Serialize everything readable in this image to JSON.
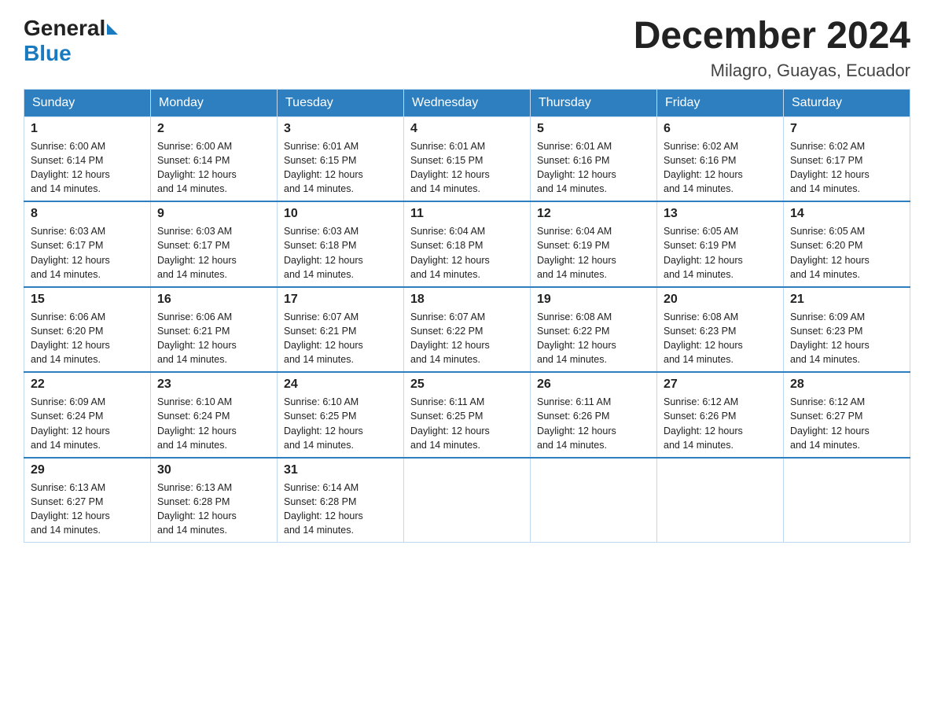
{
  "logo": {
    "general": "General",
    "triangle": "",
    "blue": "Blue"
  },
  "title": "December 2024",
  "location": "Milagro, Guayas, Ecuador",
  "days_of_week": [
    "Sunday",
    "Monday",
    "Tuesday",
    "Wednesday",
    "Thursday",
    "Friday",
    "Saturday"
  ],
  "weeks": [
    [
      {
        "day": "1",
        "sunrise": "6:00 AM",
        "sunset": "6:14 PM",
        "daylight": "12 hours and 14 minutes."
      },
      {
        "day": "2",
        "sunrise": "6:00 AM",
        "sunset": "6:14 PM",
        "daylight": "12 hours and 14 minutes."
      },
      {
        "day": "3",
        "sunrise": "6:01 AM",
        "sunset": "6:15 PM",
        "daylight": "12 hours and 14 minutes."
      },
      {
        "day": "4",
        "sunrise": "6:01 AM",
        "sunset": "6:15 PM",
        "daylight": "12 hours and 14 minutes."
      },
      {
        "day": "5",
        "sunrise": "6:01 AM",
        "sunset": "6:16 PM",
        "daylight": "12 hours and 14 minutes."
      },
      {
        "day": "6",
        "sunrise": "6:02 AM",
        "sunset": "6:16 PM",
        "daylight": "12 hours and 14 minutes."
      },
      {
        "day": "7",
        "sunrise": "6:02 AM",
        "sunset": "6:17 PM",
        "daylight": "12 hours and 14 minutes."
      }
    ],
    [
      {
        "day": "8",
        "sunrise": "6:03 AM",
        "sunset": "6:17 PM",
        "daylight": "12 hours and 14 minutes."
      },
      {
        "day": "9",
        "sunrise": "6:03 AM",
        "sunset": "6:17 PM",
        "daylight": "12 hours and 14 minutes."
      },
      {
        "day": "10",
        "sunrise": "6:03 AM",
        "sunset": "6:18 PM",
        "daylight": "12 hours and 14 minutes."
      },
      {
        "day": "11",
        "sunrise": "6:04 AM",
        "sunset": "6:18 PM",
        "daylight": "12 hours and 14 minutes."
      },
      {
        "day": "12",
        "sunrise": "6:04 AM",
        "sunset": "6:19 PM",
        "daylight": "12 hours and 14 minutes."
      },
      {
        "day": "13",
        "sunrise": "6:05 AM",
        "sunset": "6:19 PM",
        "daylight": "12 hours and 14 minutes."
      },
      {
        "day": "14",
        "sunrise": "6:05 AM",
        "sunset": "6:20 PM",
        "daylight": "12 hours and 14 minutes."
      }
    ],
    [
      {
        "day": "15",
        "sunrise": "6:06 AM",
        "sunset": "6:20 PM",
        "daylight": "12 hours and 14 minutes."
      },
      {
        "day": "16",
        "sunrise": "6:06 AM",
        "sunset": "6:21 PM",
        "daylight": "12 hours and 14 minutes."
      },
      {
        "day": "17",
        "sunrise": "6:07 AM",
        "sunset": "6:21 PM",
        "daylight": "12 hours and 14 minutes."
      },
      {
        "day": "18",
        "sunrise": "6:07 AM",
        "sunset": "6:22 PM",
        "daylight": "12 hours and 14 minutes."
      },
      {
        "day": "19",
        "sunrise": "6:08 AM",
        "sunset": "6:22 PM",
        "daylight": "12 hours and 14 minutes."
      },
      {
        "day": "20",
        "sunrise": "6:08 AM",
        "sunset": "6:23 PM",
        "daylight": "12 hours and 14 minutes."
      },
      {
        "day": "21",
        "sunrise": "6:09 AM",
        "sunset": "6:23 PM",
        "daylight": "12 hours and 14 minutes."
      }
    ],
    [
      {
        "day": "22",
        "sunrise": "6:09 AM",
        "sunset": "6:24 PM",
        "daylight": "12 hours and 14 minutes."
      },
      {
        "day": "23",
        "sunrise": "6:10 AM",
        "sunset": "6:24 PM",
        "daylight": "12 hours and 14 minutes."
      },
      {
        "day": "24",
        "sunrise": "6:10 AM",
        "sunset": "6:25 PM",
        "daylight": "12 hours and 14 minutes."
      },
      {
        "day": "25",
        "sunrise": "6:11 AM",
        "sunset": "6:25 PM",
        "daylight": "12 hours and 14 minutes."
      },
      {
        "day": "26",
        "sunrise": "6:11 AM",
        "sunset": "6:26 PM",
        "daylight": "12 hours and 14 minutes."
      },
      {
        "day": "27",
        "sunrise": "6:12 AM",
        "sunset": "6:26 PM",
        "daylight": "12 hours and 14 minutes."
      },
      {
        "day": "28",
        "sunrise": "6:12 AM",
        "sunset": "6:27 PM",
        "daylight": "12 hours and 14 minutes."
      }
    ],
    [
      {
        "day": "29",
        "sunrise": "6:13 AM",
        "sunset": "6:27 PM",
        "daylight": "12 hours and 14 minutes."
      },
      {
        "day": "30",
        "sunrise": "6:13 AM",
        "sunset": "6:28 PM",
        "daylight": "12 hours and 14 minutes."
      },
      {
        "day": "31",
        "sunrise": "6:14 AM",
        "sunset": "6:28 PM",
        "daylight": "12 hours and 14 minutes."
      },
      null,
      null,
      null,
      null
    ]
  ],
  "labels": {
    "sunrise": "Sunrise:",
    "sunset": "Sunset:",
    "daylight": "Daylight:"
  }
}
